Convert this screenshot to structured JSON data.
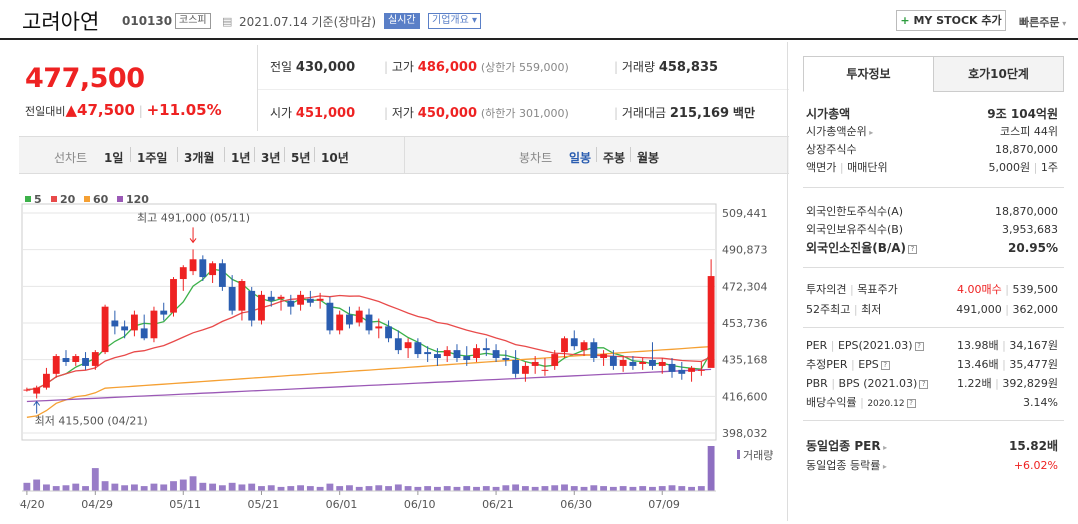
{
  "header": {
    "title": "고려아연",
    "code": "010130",
    "market": "코스피",
    "date": "2021.07.14 기준(장마감)",
    "realtime": "실시간",
    "company": "기업개요",
    "mystock": "MY STOCK 추가",
    "quick_order": "빠른주문"
  },
  "price": {
    "current": "477,500",
    "change_label": "전일대비",
    "change": "▲47,500",
    "change_pct": "+11.05%"
  },
  "stats": {
    "prev_label": "전일",
    "prev": "430,000",
    "high_label": "고가",
    "high": "486,000",
    "high_limit": "(상한가 559,000)",
    "volume_label": "거래량",
    "volume": "458,835",
    "open_label": "시가",
    "open": "451,000",
    "low_label": "저가",
    "low": "450,000",
    "low_limit": "(하한가 301,000)",
    "amount_label": "거래대금",
    "amount": "215,169",
    "amount_unit": "백만"
  },
  "periods": {
    "line_label": "선차트",
    "items": [
      "1일",
      "1주일",
      "3개월",
      "1년",
      "3년",
      "5년",
      "10년"
    ],
    "candle_label": "봉차트",
    "candle_items": [
      "일봉",
      "주봉",
      "월봉"
    ]
  },
  "side": {
    "tab1": "투자정보",
    "tab2": "호가10단계",
    "market_cap_label": "시가총액",
    "market_cap": "9조 104억원",
    "cap_rank_label": "시가총액순위",
    "cap_rank": "코스피 44위",
    "shares_label": "상장주식수",
    "shares": "18,870,000",
    "par_label": "액면가",
    "par_label2": "매매단위",
    "par": "5,000원",
    "par2": "1주",
    "foreign_limit_label": "외국인한도주식수(A)",
    "foreign_limit": "18,870,000",
    "foreign_hold_label": "외국인보유주식수(B)",
    "foreign_hold": "3,953,683",
    "foreign_ratio_label": "외국인소진율(B/A)",
    "foreign_ratio": "20.95%",
    "opinion_label": "투자의견",
    "target_label": "목표주가",
    "opinion": "4.00매수",
    "target": "539,500",
    "w52_label": "52주최고",
    "w52_low_label": "최저",
    "w52_high": "491,000",
    "w52_low": "362,000",
    "per_label": "PER",
    "eps_label": "EPS(2021.03)",
    "per": "13.98배",
    "eps": "34,167원",
    "eper_label": "추정PER",
    "eeps_label": "EPS",
    "eper": "13.46배",
    "eeps": "35,477원",
    "pbr_label": "PBR",
    "bps_label": "BPS (2021.03)",
    "pbr": "1.22배",
    "bps": "392,829원",
    "div_label": "배당수익률",
    "div_date": "2020.12",
    "div": "3.14%",
    "sector_per_label": "동일업종 PER",
    "sector_per": "15.82배",
    "sector_chg_label": "동일업종 등락률",
    "sector_chg": "+6.02%"
  },
  "chart_data": {
    "type": "candlestick",
    "legend": [
      {
        "name": "5",
        "color": "#3cb14a"
      },
      {
        "name": "20",
        "color": "#e84a4a"
      },
      {
        "name": "60",
        "color": "#f5a033"
      },
      {
        "name": "120",
        "color": "#9b59b6"
      }
    ],
    "ylim": [
      398032,
      509441
    ],
    "y_ticks": [
      "509,441",
      "490,873",
      "472,304",
      "453,736",
      "435,168",
      "416,600",
      "398,032"
    ],
    "x_ticks": [
      "04/20",
      "04/29",
      "05/11",
      "05/21",
      "06/01",
      "06/10",
      "06/21",
      "06/30",
      "07/09"
    ],
    "max_label": "최고 491,000 (05/11)",
    "min_label": "최저 415,500 (04/21)",
    "volume_label": "거래량",
    "candles": [
      [
        420000,
        421000,
        419000,
        420000
      ],
      [
        418000,
        422000,
        415500,
        421000
      ],
      [
        421000,
        431000,
        420000,
        428000
      ],
      [
        428000,
        438000,
        426000,
        437000
      ],
      [
        436000,
        440000,
        432000,
        434000
      ],
      [
        434000,
        438000,
        432000,
        437000
      ],
      [
        436000,
        439000,
        430000,
        432000
      ],
      [
        432000,
        440000,
        430000,
        439000
      ],
      [
        439000,
        463000,
        438000,
        462000
      ],
      [
        455000,
        460000,
        448000,
        452000
      ],
      [
        452000,
        455000,
        446000,
        450000
      ],
      [
        450000,
        460000,
        447000,
        458000
      ],
      [
        451000,
        458000,
        445000,
        446000
      ],
      [
        446000,
        462000,
        444000,
        460000
      ],
      [
        460000,
        464000,
        455000,
        458000
      ],
      [
        459000,
        477000,
        457000,
        476000
      ],
      [
        476000,
        483000,
        470000,
        482000
      ],
      [
        480000,
        491000,
        478000,
        486000
      ],
      [
        486000,
        488000,
        475000,
        477000
      ],
      [
        478000,
        485000,
        474000,
        484000
      ],
      [
        484000,
        486000,
        470000,
        472000
      ],
      [
        472000,
        478000,
        458000,
        460000
      ],
      [
        460000,
        476000,
        455000,
        475000
      ],
      [
        470000,
        472000,
        452000,
        455000
      ],
      [
        455000,
        470000,
        453000,
        468000
      ],
      [
        467000,
        470000,
        462000,
        465000
      ],
      [
        466000,
        468000,
        460000,
        467000
      ],
      [
        465000,
        468000,
        458000,
        462000
      ],
      [
        463000,
        470000,
        460000,
        468000
      ],
      [
        466000,
        470000,
        462000,
        464000
      ],
      [
        465000,
        469000,
        461000,
        466000
      ],
      [
        464000,
        467000,
        448000,
        450000
      ],
      [
        450000,
        460000,
        448000,
        458000
      ],
      [
        458000,
        462000,
        451000,
        453000
      ],
      [
        454000,
        462000,
        452000,
        460000
      ],
      [
        458000,
        461000,
        448000,
        450000
      ],
      [
        451000,
        456000,
        446000,
        452000
      ],
      [
        452000,
        455000,
        444000,
        446000
      ],
      [
        446000,
        450000,
        438000,
        440000
      ],
      [
        441000,
        446000,
        436000,
        444000
      ],
      [
        444000,
        446000,
        436000,
        438000
      ],
      [
        439000,
        442000,
        434000,
        438000
      ],
      [
        438000,
        441000,
        432000,
        436000
      ],
      [
        437000,
        442000,
        434000,
        440000
      ],
      [
        440000,
        443000,
        434000,
        436000
      ],
      [
        437000,
        442000,
        432000,
        435000
      ],
      [
        436000,
        443000,
        434000,
        441000
      ],
      [
        441000,
        446000,
        437000,
        440000
      ],
      [
        440000,
        443000,
        434000,
        436000
      ],
      [
        436000,
        440000,
        432000,
        435000
      ],
      [
        435000,
        440000,
        426000,
        428000
      ],
      [
        428000,
        434000,
        424000,
        432000
      ],
      [
        432000,
        437000,
        428000,
        434000
      ],
      [
        430000,
        436000,
        427000,
        430000
      ],
      [
        432000,
        440000,
        430000,
        438000
      ],
      [
        439000,
        447000,
        436000,
        446000
      ],
      [
        446000,
        450000,
        440000,
        442000
      ],
      [
        440000,
        445000,
        437000,
        444000
      ],
      [
        444000,
        446000,
        434000,
        436000
      ],
      [
        436000,
        440000,
        432000,
        438000
      ],
      [
        437000,
        440000,
        430000,
        432000
      ],
      [
        432000,
        437000,
        429000,
        435000
      ],
      [
        434000,
        437000,
        430000,
        432000
      ],
      [
        433000,
        436000,
        430000,
        434000
      ],
      [
        435000,
        444000,
        430000,
        432000
      ],
      [
        432000,
        436000,
        428000,
        434000
      ],
      [
        433000,
        436000,
        426000,
        429000
      ],
      [
        430000,
        434000,
        425000,
        428000
      ],
      [
        429000,
        432000,
        424000,
        431000
      ],
      [
        430000,
        434000,
        427000,
        430000
      ],
      [
        431000,
        486000,
        450000,
        477500
      ]
    ],
    "volumes": [
      10,
      14,
      8,
      6,
      7,
      9,
      6,
      28,
      12,
      9,
      7,
      8,
      6,
      9,
      8,
      12,
      14,
      18,
      10,
      9,
      7,
      10,
      8,
      9,
      6,
      7,
      5,
      6,
      7,
      6,
      5,
      9,
      6,
      7,
      5,
      6,
      7,
      6,
      8,
      6,
      5,
      6,
      5,
      6,
      5,
      6,
      5,
      6,
      5,
      7,
      8,
      6,
      5,
      6,
      7,
      8,
      6,
      5,
      7,
      6,
      5,
      6,
      5,
      6,
      5,
      6,
      7,
      6,
      5,
      6,
      55
    ]
  }
}
